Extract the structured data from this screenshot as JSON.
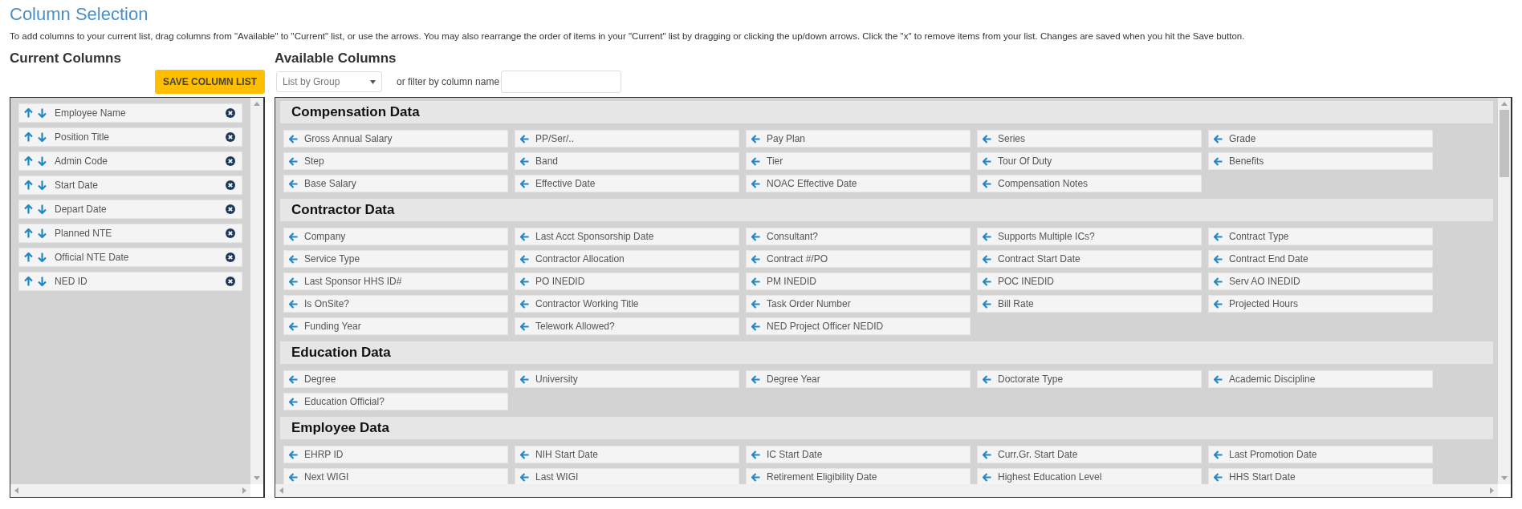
{
  "title": "Column Selection",
  "instructions": "To add columns to your current list, drag columns from \"Available\" to \"Current\" list, or use the arrows. You may also rearrange the order of items in your \"Current\" list by dragging or clicking the up/down arrows. Click the \"x\" to remove items from your list. Changes are saved when you hit the Save button.",
  "current": {
    "heading": "Current Columns",
    "save_button": "SAVE COLUMN LIST",
    "items": [
      "Employee Name",
      "Position Title",
      "Admin Code",
      "Start Date",
      "Depart Date",
      "Planned NTE",
      "Official NTE Date",
      "NED ID"
    ]
  },
  "available": {
    "heading": "Available Columns",
    "group_select": "List by Group",
    "filter_label": "or filter by column name",
    "groups": [
      {
        "name": "Compensation Data",
        "items": [
          "Gross Annual Salary",
          "PP/Ser/..",
          "Pay Plan",
          "Series",
          "Grade",
          "Step",
          "Band",
          "Tier",
          "Tour Of Duty",
          "Benefits",
          "Base Salary",
          "Effective Date",
          "NOAC Effective Date",
          "Compensation Notes"
        ]
      },
      {
        "name": "Contractor Data",
        "items": [
          "Company",
          "Last Acct Sponsorship Date",
          "Consultant?",
          "Supports Multiple ICs?",
          "Contract Type",
          "Service Type",
          "Contractor Allocation",
          "Contract #/PO",
          "Contract Start Date",
          "Contract End Date",
          "Last Sponsor HHS ID#",
          "PO INEDID",
          "PM INEDID",
          "POC INEDID",
          "Serv AO INEDID",
          "Is OnSite?",
          "Contractor Working Title",
          "Task Order Number",
          "Bill Rate",
          "Projected Hours",
          "Funding Year",
          "Telework Allowed?",
          "NED Project Officer NEDID"
        ]
      },
      {
        "name": "Education Data",
        "items": [
          "Degree",
          "University",
          "Degree Year",
          "Doctorate Type",
          "Academic Discipline",
          "Education Official?"
        ]
      },
      {
        "name": "Employee Data",
        "items": [
          "EHRP ID",
          "NIH Start Date",
          "IC Start Date",
          "Curr.Gr. Start Date",
          "Last Promotion Date",
          "Next WIGI",
          "Last WIGI",
          "Retirement Eligibility Date",
          "Highest Education Level",
          "HHS Start Date"
        ]
      }
    ]
  }
}
